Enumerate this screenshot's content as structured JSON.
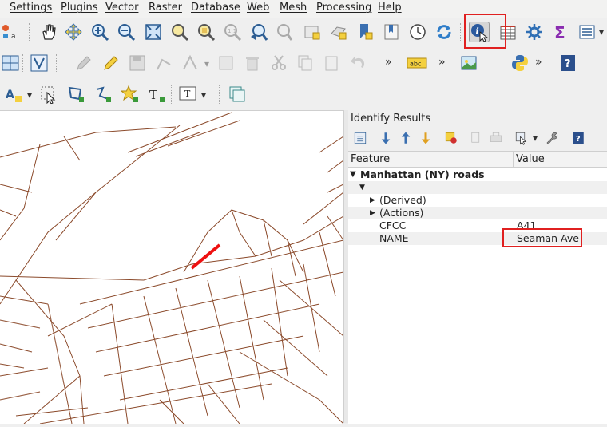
{
  "menu": {
    "items": [
      {
        "id": "settings",
        "label": "Settings"
      },
      {
        "id": "plugins",
        "label": "Plugins"
      },
      {
        "id": "vector",
        "label": "Vector"
      },
      {
        "id": "raster",
        "label": "Raster"
      },
      {
        "id": "database",
        "label": "Database"
      },
      {
        "id": "web",
        "label": "Web"
      },
      {
        "id": "mesh",
        "label": "Mesh"
      },
      {
        "id": "processing",
        "label": "Processing"
      },
      {
        "id": "help",
        "label": "Help"
      }
    ]
  },
  "toolbar": {
    "labeling_tag": "abc",
    "overflow": "»",
    "identify_active": true
  },
  "identify": {
    "title": "Identify Results",
    "col_feature": "Feature",
    "col_value": "Value",
    "layer_name": "Manhattan (NY) roads",
    "derived_label": "(Derived)",
    "actions_label": "(Actions)",
    "fields": [
      {
        "name": "CFCC",
        "value": "A41"
      },
      {
        "name": "NAME",
        "value": "Seaman Ave"
      }
    ]
  },
  "colors": {
    "road": "#8b4a2b",
    "selected_road": "#ee1111",
    "highlight_box": "#e02020"
  }
}
